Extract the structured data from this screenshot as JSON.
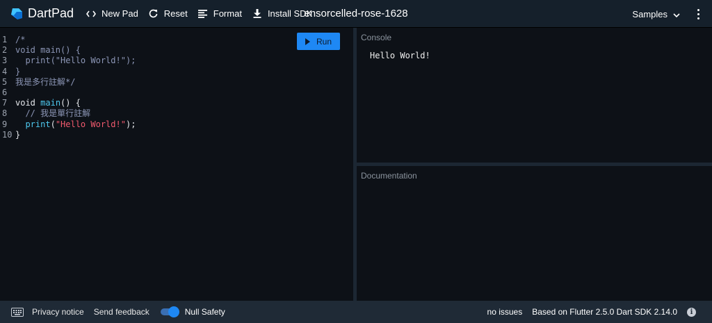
{
  "header": {
    "logo_text": "DartPad",
    "new_pad": "New Pad",
    "reset": "Reset",
    "format": "Format",
    "install_sdk": "Install SDK",
    "title": "ensorcelled-rose-1628",
    "samples": "Samples"
  },
  "editor": {
    "run_label": "Run",
    "line_numbers": [
      "1",
      "2",
      "3",
      "4",
      "5",
      "6",
      "7",
      "8",
      "9",
      "10"
    ],
    "lines": [
      "/*",
      "void main() {",
      "  print(\"Hello World!\");",
      "}",
      "我是多行註解*/",
      "",
      "void main() {",
      "  // 我是單行註解",
      "  print(\"Hello World!\");",
      "}"
    ],
    "tokens": {
      "void": "void",
      "main": "main",
      "parens_open": "() {",
      "comment": "// 我是單行註解",
      "print": "print",
      "lp": "(",
      "string": "\"Hello World!\"",
      "rp": ");",
      "close": "}"
    }
  },
  "console": {
    "label": "Console",
    "output": "Hello World!"
  },
  "documentation": {
    "label": "Documentation"
  },
  "footer": {
    "privacy": "Privacy notice",
    "feedback": "Send feedback",
    "null_safety": "Null Safety",
    "null_safety_enabled": true,
    "issues": "no issues",
    "based_on": "Based on Flutter 2.5.0 Dart SDK 2.14.0"
  },
  "colors": {
    "accent": "#1e88f4",
    "header_bg": "#15202b",
    "editor_bg": "#0d1117",
    "footer_bg": "#1f2a36",
    "string": "#f25a6e",
    "function": "#4ec9f0"
  }
}
